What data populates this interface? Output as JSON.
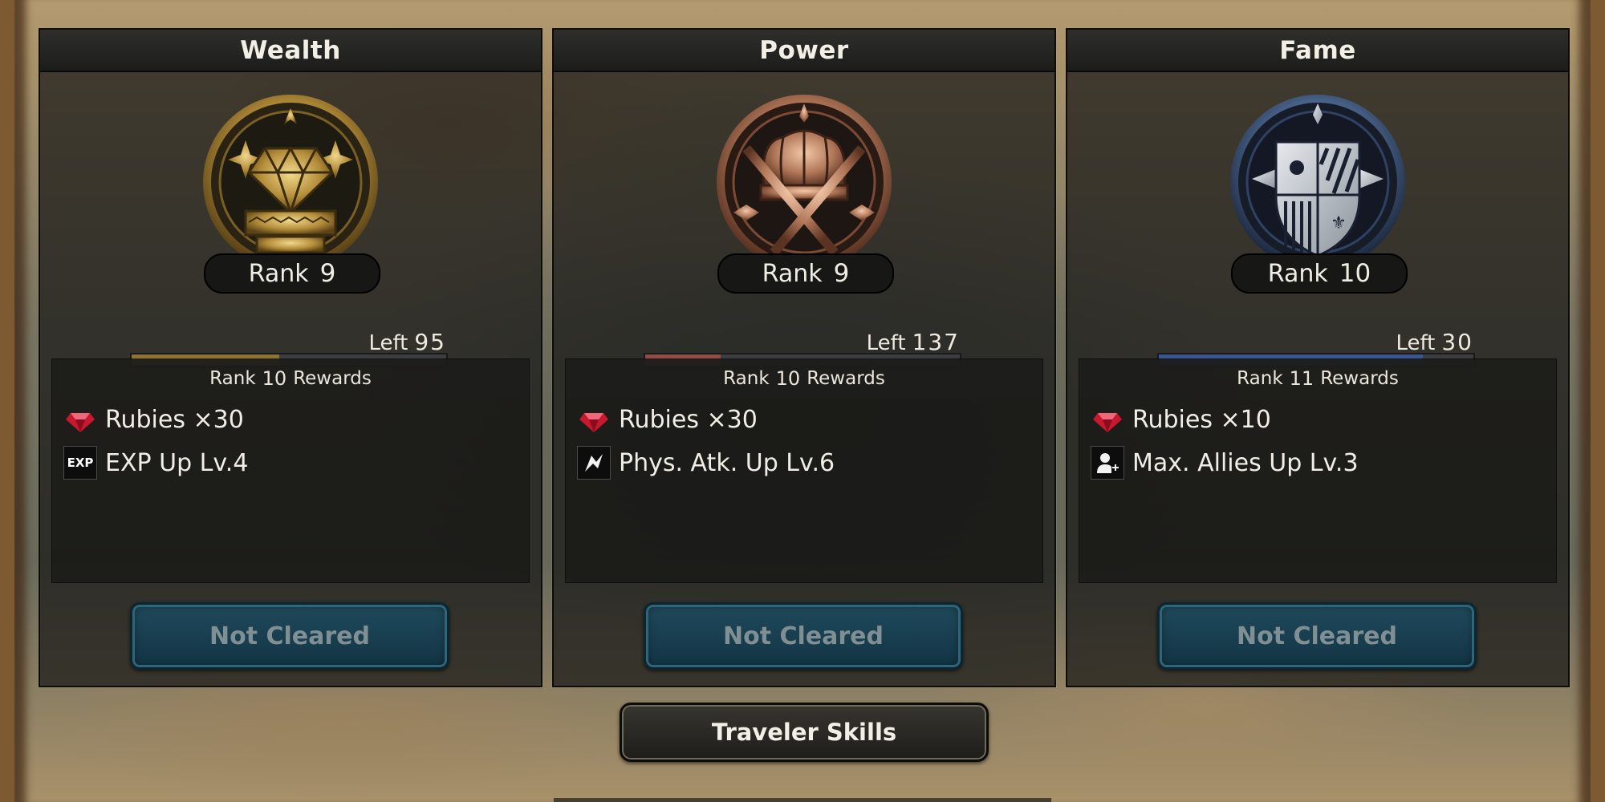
{
  "panels": [
    {
      "title": "Wealth",
      "emblem_icon": "gem-crest-icon",
      "emblem_color": "#b48d3a",
      "rank_label": "Rank",
      "rank": "9",
      "left_label": "Left",
      "left": "95",
      "progress": 0.47,
      "progress_color": "#8c7335",
      "rewards_prefix": "Rank",
      "rewards_rank": "10",
      "rewards_suffix": "Rewards",
      "rewards": [
        {
          "icon": "ruby-icon",
          "label": "Rubies ×30"
        },
        {
          "icon": "exp-icon",
          "icon_text": "EXP",
          "label": "EXP Up Lv.4"
        }
      ],
      "status": "Not Cleared"
    },
    {
      "title": "Power",
      "emblem_icon": "crown-swords-icon",
      "emblem_color": "#b07658",
      "rank_label": "Rank",
      "rank": "9",
      "left_label": "Left",
      "left": "137",
      "progress": 0.24,
      "progress_color": "#8e4c47",
      "rewards_prefix": "Rank",
      "rewards_rank": "10",
      "rewards_suffix": "Rewards",
      "rewards": [
        {
          "icon": "ruby-icon",
          "label": "Rubies ×30"
        },
        {
          "icon": "phys-atk-icon",
          "icon_text": "",
          "label": "Phys. Atk. Up Lv.6"
        }
      ],
      "status": "Not Cleared"
    },
    {
      "title": "Fame",
      "emblem_icon": "shield-banner-icon",
      "emblem_color": "#4d6890",
      "rank_label": "Rank",
      "rank": "10",
      "left_label": "Left",
      "left": "30",
      "progress": 0.84,
      "progress_color": "#3c548e",
      "rewards_prefix": "Rank",
      "rewards_rank": "11",
      "rewards_suffix": "Rewards",
      "rewards": [
        {
          "icon": "ruby-icon",
          "label": "Rubies ×10"
        },
        {
          "icon": "add-ally-icon",
          "icon_text": "",
          "label": "Max. Allies Up Lv.3"
        }
      ],
      "status": "Not Cleared"
    }
  ],
  "traveler_button": "Traveler Skills"
}
